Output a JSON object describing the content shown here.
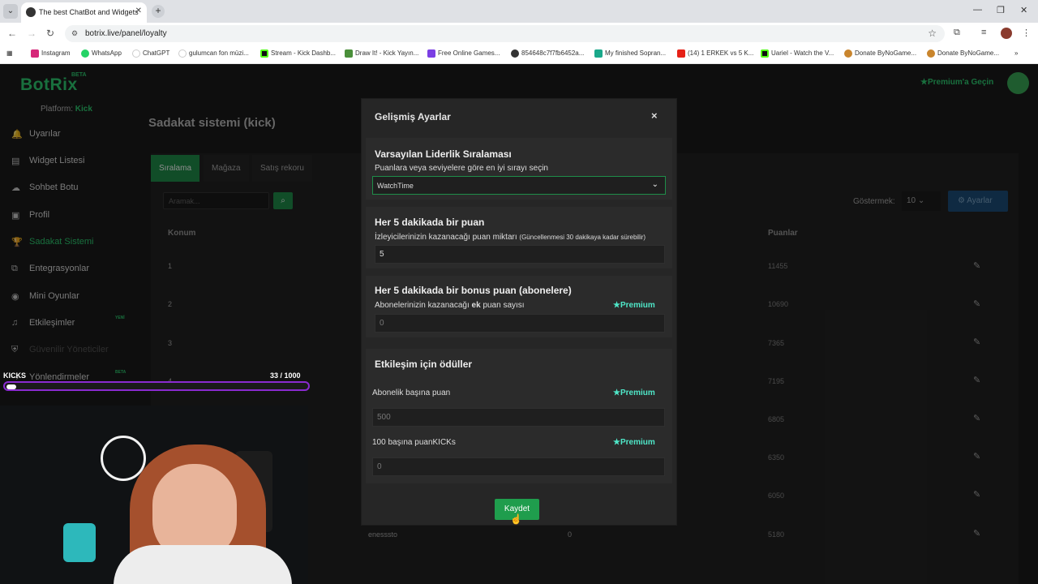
{
  "browser": {
    "tab_title": "The best ChatBot and Widgets",
    "url": "botrix.live/panel/loyalty",
    "bookmarks": [
      "Instagram",
      "WhatsApp",
      "ChatGPT",
      "gulumcan fon müzi...",
      "Stream - Kick Dashb...",
      "Draw It! - Kick Yayın...",
      "Free Online Games...",
      "854648c7f7fb6452a...",
      "My finished Sopran...",
      "(14) 1 ERKEK vs 5 K...",
      "Uariel - Watch the V...",
      "Donate ByNoGame...",
      "Donate ByNoGame..."
    ]
  },
  "app": {
    "logo": "BotRix",
    "logo_badge": "BETA",
    "platform_label": "Platform:",
    "platform_value": "Kick",
    "premium_cta": "Premium'a Geçin",
    "sidebar": [
      {
        "label": "Uyarılar",
        "icon": "bell-icon"
      },
      {
        "label": "Widget Listesi",
        "icon": "list-icon"
      },
      {
        "label": "Sohbet Botu",
        "icon": "robot-icon"
      },
      {
        "label": "Profil",
        "icon": "profile-card-icon"
      },
      {
        "label": "Sadakat Sistemi",
        "icon": "trophy-icon"
      },
      {
        "label": "Entegrasyonlar",
        "icon": "integration-icon"
      },
      {
        "label": "Mini Oyunlar",
        "icon": "gamepad-icon"
      },
      {
        "label": "Etkileşimler",
        "icon": "music-note-icon",
        "badge": "YENİ"
      },
      {
        "label": "Güvenilir Yöneticiler",
        "icon": "shield-icon"
      },
      {
        "label": "Yönlendirmeler",
        "icon": "redirect-icon",
        "badge": "BETA"
      }
    ]
  },
  "main": {
    "title": "Sadakat sistemi (kick)",
    "tabs": [
      "Sıralama",
      "Mağaza",
      "Satış rekoru"
    ],
    "search_placeholder": "Aramak...",
    "show_label": "Göstermek:",
    "show_value": "10",
    "settings_button": "Ayarlar",
    "columns": {
      "position": "Konum",
      "points": "Puanlar"
    },
    "rows": [
      {
        "pos": "1",
        "points": "11455"
      },
      {
        "pos": "2",
        "points": "10690"
      },
      {
        "pos": "3",
        "points": "7365"
      },
      {
        "pos": "4",
        "points": "7195"
      },
      {
        "pos": "",
        "points": "6805"
      },
      {
        "pos": "",
        "points": "6350"
      },
      {
        "pos": "",
        "points": "6050"
      },
      {
        "pos": "",
        "user": "enesssto",
        "zero": "0",
        "points": "5180"
      }
    ]
  },
  "modal": {
    "title": "Gelişmiş Ayarlar",
    "close": "×",
    "leaderboard": {
      "title": "Varsayılan Liderlik Sıralaması",
      "sub": "Puanlara veya seviyelere göre en iyi sırayı seçin",
      "value": "WatchTime"
    },
    "points": {
      "title": "Her 5 dakikada bir puan",
      "sub": "İzleyicilerinizin kazanacağı puan miktarı",
      "note": "(Güncellenmesi 30 dakikaya kadar sürebilir)",
      "value": "5"
    },
    "bonus": {
      "title": "Her 5 dakikada bir bonus puan (abonelere)",
      "sub_before": "Abonelerinizin kazanacağı",
      "sub_bold": "ek",
      "sub_after": "puan sayısı",
      "premium": "Premium",
      "value": "0"
    },
    "rewards": {
      "title": "Etkileşim için ödüller",
      "sub_label": "Abonelik başına puan",
      "sub_value": "500",
      "kicks_label": "100 başına puanKICKs",
      "kicks_value": "0",
      "premium": "Premium"
    },
    "save": "Kaydet"
  },
  "stream_overlay": {
    "label": "KICKS",
    "count": "33  / 1000",
    "progress": 0.033
  }
}
